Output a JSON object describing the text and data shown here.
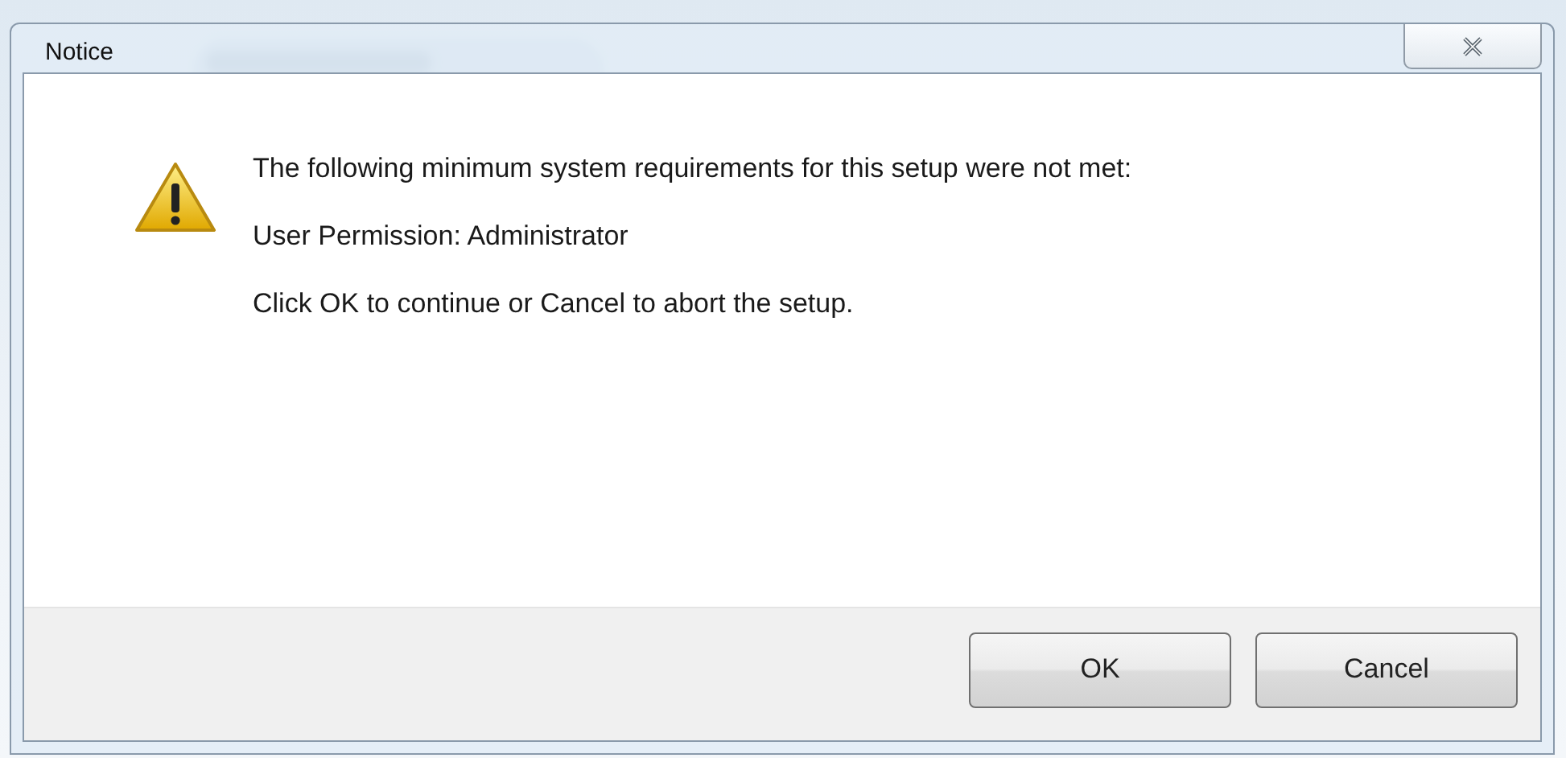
{
  "window": {
    "title": "Notice"
  },
  "message": {
    "lines": [
      "The following minimum system requirements for this setup were not met:",
      "User Permission: Administrator",
      "Click OK to continue or Cancel to abort the setup."
    ]
  },
  "buttons": [
    {
      "label": "OK"
    },
    {
      "label": "Cancel"
    }
  ]
}
